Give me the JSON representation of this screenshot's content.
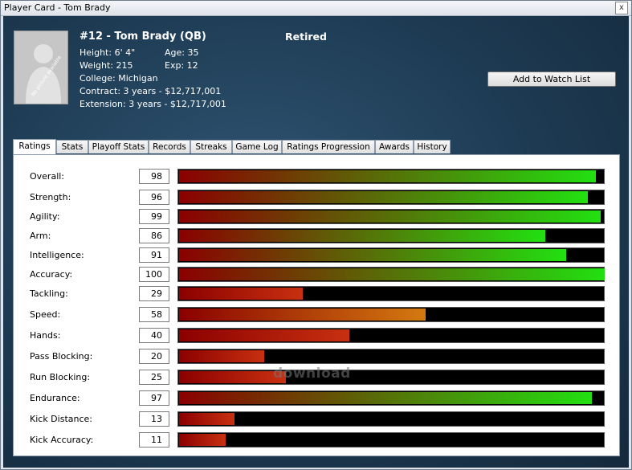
{
  "window": {
    "title": "Player Card - Tom Brady",
    "close_glyph": "x"
  },
  "photo": {
    "placeholder_text": "No picture available"
  },
  "player": {
    "name": "#12 - Tom Brady (QB)",
    "status": "Retired",
    "height": "Height: 6' 4\"",
    "age": "Age: 35",
    "weight": "Weight: 215",
    "exp": "Exp: 12",
    "college": "College: Michigan",
    "contract": "Contract: 3 years - $12,717,001",
    "extension": "Extension: 3 years - $12,717,001"
  },
  "actions": {
    "watch_label": "Add to Watch List"
  },
  "tabs": [
    {
      "label": "Ratings",
      "active": true
    },
    {
      "label": "Stats"
    },
    {
      "label": "Playoff Stats"
    },
    {
      "label": "Records"
    },
    {
      "label": "Streaks"
    },
    {
      "label": "Game Log"
    },
    {
      "label": "Ratings Progression"
    },
    {
      "label": "Awards"
    },
    {
      "label": "History"
    }
  ],
  "ratings": [
    {
      "label": "Overall:",
      "value": "98"
    },
    {
      "label": "Strength:",
      "value": "96"
    },
    {
      "label": "Agility:",
      "value": "99"
    },
    {
      "label": "Arm:",
      "value": "86"
    },
    {
      "label": "Intelligence:",
      "value": "91"
    },
    {
      "label": "Accuracy:",
      "value": "100"
    },
    {
      "label": "Tackling:",
      "value": "29"
    },
    {
      "label": "Speed:",
      "value": "58"
    },
    {
      "label": "Hands:",
      "value": "40"
    },
    {
      "label": "Pass Blocking:",
      "value": "20"
    },
    {
      "label": "Run Blocking:",
      "value": "25"
    },
    {
      "label": "Endurance:",
      "value": "97"
    },
    {
      "label": "Kick Distance:",
      "value": "13"
    },
    {
      "label": "Kick Accuracy:",
      "value": "11"
    }
  ],
  "colors": {
    "low": "#8b0000",
    "mid": "#d47a10",
    "high": "#22e010"
  }
}
